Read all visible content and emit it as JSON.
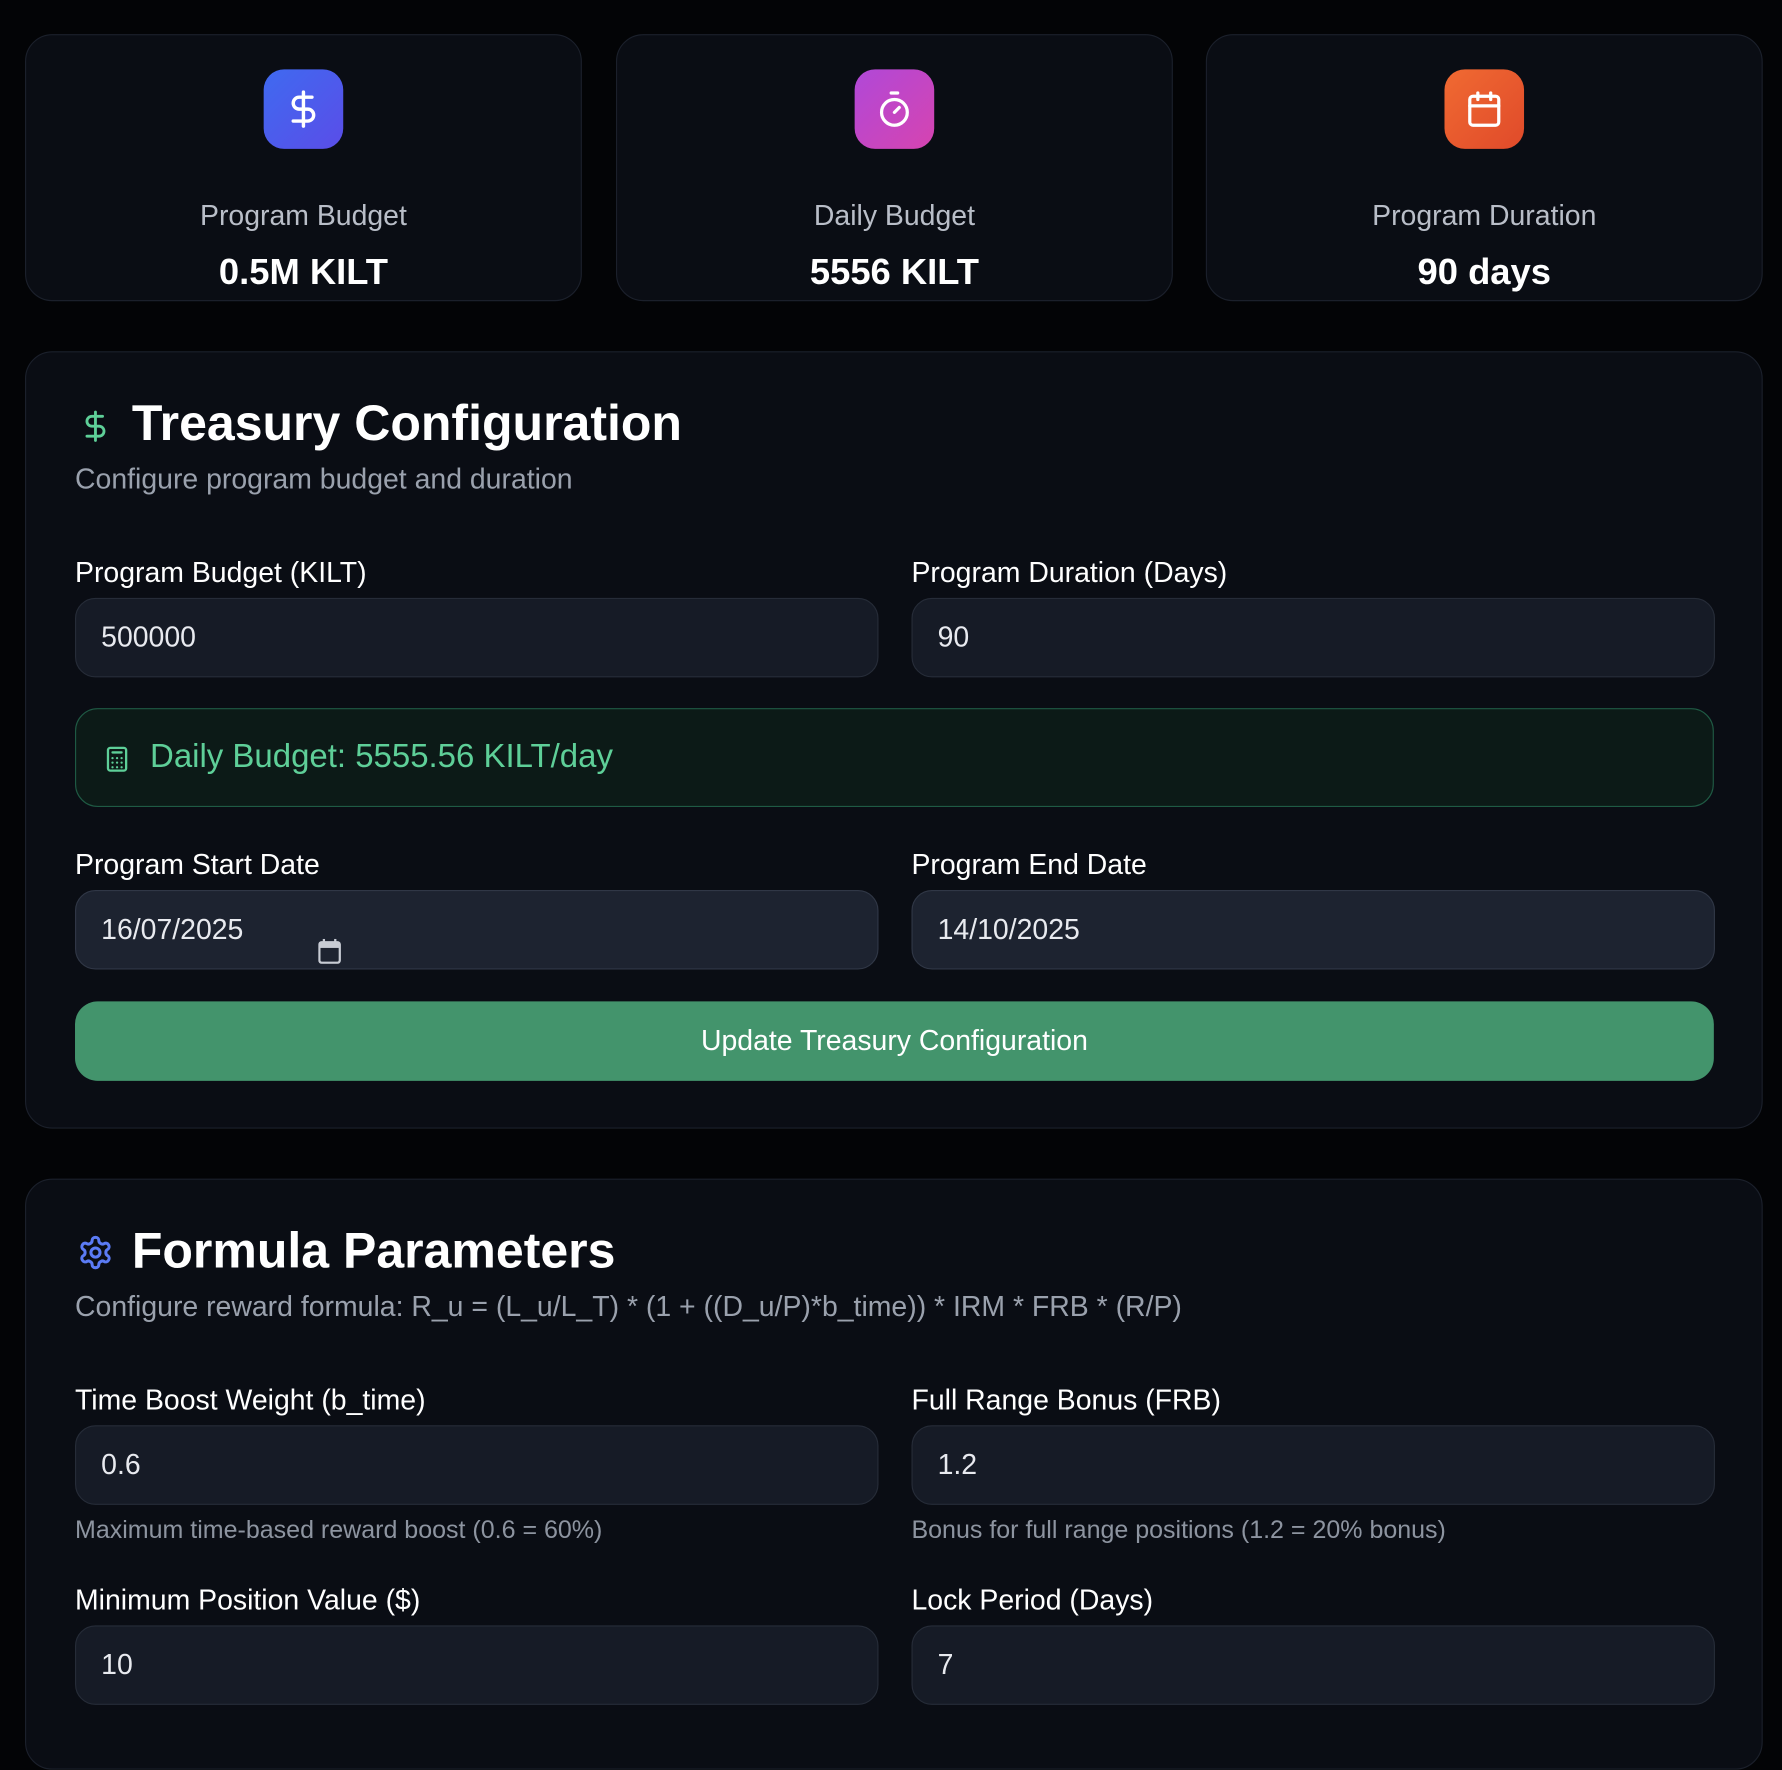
{
  "stats": [
    {
      "label": "Program Budget",
      "value": "0.5M KILT",
      "icon": "dollar-icon",
      "color_from": "#3f6af0",
      "color_to": "#5a4de8"
    },
    {
      "label": "Daily Budget",
      "value": "5556 KILT",
      "icon": "timer-icon",
      "color_from": "#b048d8",
      "color_to": "#d644b0"
    },
    {
      "label": "Program Duration",
      "value": "90 days",
      "icon": "calendar-icon",
      "color_from": "#f06a32",
      "color_to": "#e04a2a"
    }
  ],
  "treasury": {
    "title": "Treasury Configuration",
    "subtitle": "Configure program budget and duration",
    "icon": "dollar-icon",
    "icon_color": "#5ecf98",
    "budget_label": "Program Budget (KILT)",
    "budget_value": "500000",
    "duration_label": "Program Duration (Days)",
    "duration_value": "90",
    "daily_budget_text": "Daily Budget: 5555.56 KILT/day",
    "daily_icon": "calculator-icon",
    "start_label": "Program Start Date",
    "start_value": "16/07/2025",
    "end_label": "Program End Date",
    "end_value": "14/10/2025",
    "update_button": "Update Treasury Configuration",
    "accent": "#43946c"
  },
  "formula": {
    "title": "Formula Parameters",
    "subtitle": "Configure reward formula: R_u = (L_u/L_T) * (1 + ((D_u/P)*b_time)) * IRM * FRB * (R/P)",
    "icon": "gear-icon",
    "icon_color": "#5b7bf5",
    "time_boost_label": "Time Boost Weight (b_time)",
    "time_boost_value": "0.6",
    "time_boost_hint": "Maximum time-based reward boost (0.6 = 60%)",
    "frb_label": "Full Range Bonus (FRB)",
    "frb_value": "1.2",
    "frb_hint": "Bonus for full range positions (1.2 = 20% bonus)",
    "min_position_label": "Minimum Position Value ($)",
    "min_position_value": "10",
    "lock_period_label": "Lock Period (Days)",
    "lock_period_value": "7"
  }
}
